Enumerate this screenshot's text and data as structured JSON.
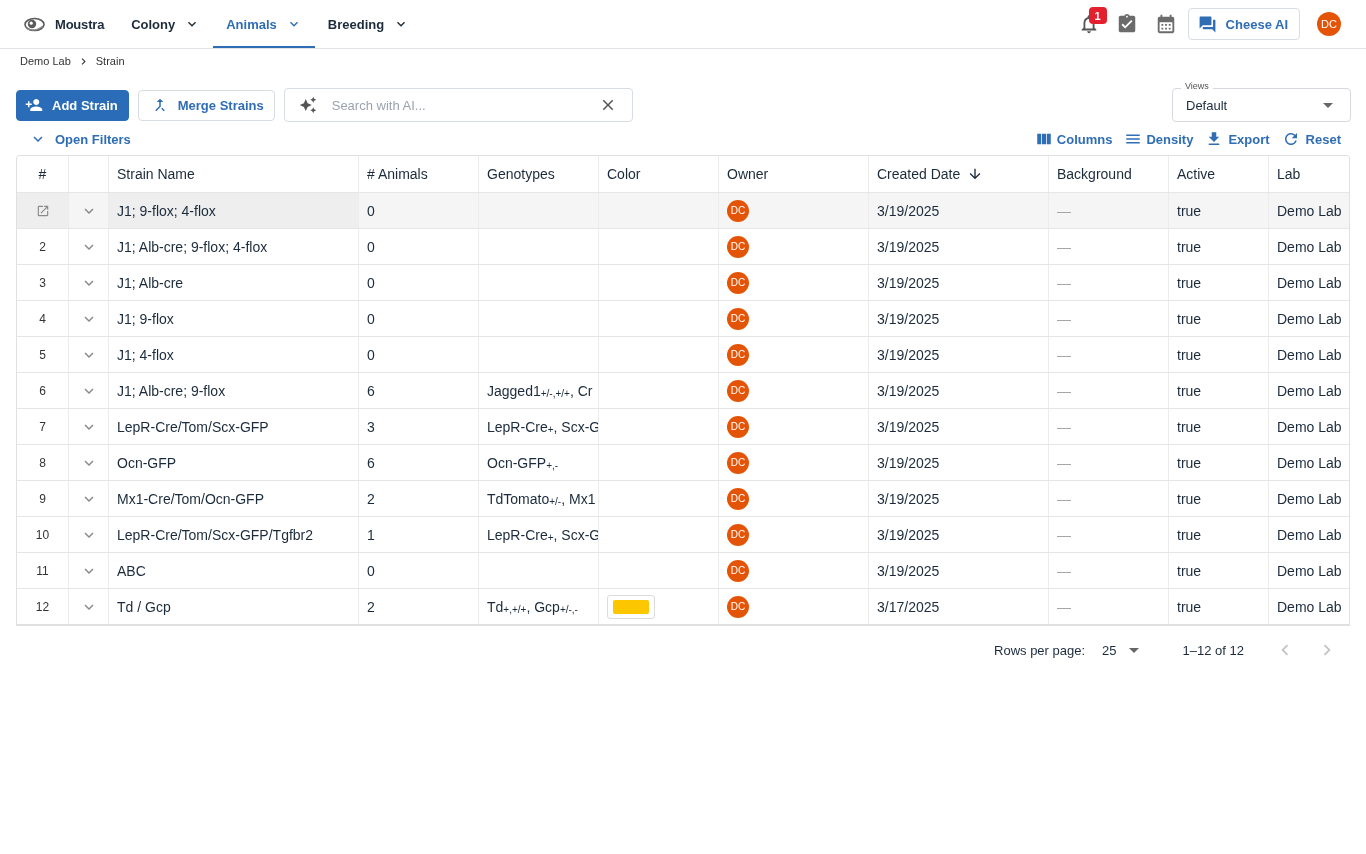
{
  "app": {
    "name": "Moustra"
  },
  "nav": [
    {
      "label": "Colony",
      "selected": false
    },
    {
      "label": "Animals",
      "selected": true
    },
    {
      "label": "Breeding",
      "selected": false
    }
  ],
  "header": {
    "notifications": {
      "count": "1"
    },
    "assistant_button": {
      "label": "Cheese AI"
    },
    "user": {
      "initials": "DC"
    }
  },
  "breadcrumb": [
    {
      "label": "Demo Lab"
    },
    {
      "label": "Strain"
    }
  ],
  "toolbar": {
    "buttons": [
      {
        "kind": "add",
        "label": "Add Strain"
      },
      {
        "kind": "merge",
        "label": "Merge Strains"
      }
    ],
    "search": {
      "placeholder": "Search with AI..."
    },
    "views": {
      "label": "Views",
      "value": "Default"
    }
  },
  "filters_toggle": {
    "label": "Open Filters"
  },
  "grid_actions": [
    {
      "kind": "columns",
      "label": "Columns"
    },
    {
      "kind": "density",
      "label": "Density"
    },
    {
      "kind": "export",
      "label": "Export"
    },
    {
      "kind": "reset",
      "label": "Reset"
    }
  ],
  "table": {
    "columns": [
      {
        "kind": "index",
        "label": "#"
      },
      {
        "kind": "expander"
      },
      {
        "kind": "text",
        "label": "Strain Name",
        "sorted": false
      },
      {
        "kind": "text",
        "label": "# Animals",
        "sorted": false
      },
      {
        "kind": "text",
        "label": "Genotypes",
        "sorted": false
      },
      {
        "kind": "text",
        "label": "Color",
        "sorted": false
      },
      {
        "kind": "text",
        "label": "Owner",
        "sorted": false
      },
      {
        "kind": "text",
        "label": "Created Date",
        "sorted": true,
        "descending": true
      },
      {
        "kind": "text",
        "label": "Background",
        "sorted": false
      },
      {
        "kind": "text",
        "label": "Active",
        "sorted": false
      },
      {
        "kind": "text",
        "label": "Lab",
        "sorted": false
      }
    ],
    "rows": [
      {
        "hovered": true,
        "expanded": false,
        "strain_name": "J1; 9-flox; 4-flox",
        "animals": "0",
        "owner": "DC",
        "created_date": "3/19/2025",
        "background": "—",
        "active": "true",
        "lab": "Demo Lab"
      },
      {
        "hovered": false,
        "expanded": false,
        "index": "2",
        "strain_name": "J1; Alb-cre; 9-flox; 4-flox",
        "animals": "0",
        "owner": "DC",
        "created_date": "3/19/2025",
        "background": "—",
        "active": "true",
        "lab": "Demo Lab"
      },
      {
        "hovered": false,
        "expanded": false,
        "index": "3",
        "strain_name": "J1; Alb-cre",
        "animals": "0",
        "owner": "DC",
        "created_date": "3/19/2025",
        "background": "—",
        "active": "true",
        "lab": "Demo Lab"
      },
      {
        "hovered": false,
        "expanded": false,
        "index": "4",
        "strain_name": "J1; 9-flox",
        "animals": "0",
        "owner": "DC",
        "created_date": "3/19/2025",
        "background": "—",
        "active": "true",
        "lab": "Demo Lab"
      },
      {
        "hovered": false,
        "expanded": false,
        "index": "5",
        "strain_name": "J1; 4-flox",
        "animals": "0",
        "owner": "DC",
        "created_date": "3/19/2025",
        "background": "—",
        "active": "true",
        "lab": "Demo Lab"
      },
      {
        "hovered": false,
        "expanded": false,
        "index": "6",
        "strain_name": "J1; Alb-cre; 9-flox",
        "animals": "6",
        "genotypes": "Jagged1$_{+/-,+/+}$, Cr",
        "owner": "DC",
        "created_date": "3/19/2025",
        "background": "—",
        "active": "true",
        "lab": "Demo Lab"
      },
      {
        "hovered": false,
        "expanded": false,
        "index": "7",
        "strain_name": "LepR-Cre/Tom/Scx-GFP",
        "animals": "3",
        "genotypes": "LepR-Cre$_{+}$, Scx-G",
        "owner": "DC",
        "created_date": "3/19/2025",
        "background": "—",
        "active": "true",
        "lab": "Demo Lab"
      },
      {
        "hovered": false,
        "expanded": false,
        "index": "8",
        "strain_name": "Ocn-GFP",
        "animals": "6",
        "genotypes": "Ocn-GFP$_{+,-}$",
        "owner": "DC",
        "created_date": "3/19/2025",
        "background": "—",
        "active": "true",
        "lab": "Demo Lab"
      },
      {
        "hovered": false,
        "expanded": false,
        "index": "9",
        "strain_name": "Mx1-Cre/Tom/Ocn-GFP",
        "animals": "2",
        "genotypes": "TdTomato$_{+/-}$, Mx1",
        "owner": "DC",
        "created_date": "3/19/2025",
        "background": "—",
        "active": "true",
        "lab": "Demo Lab"
      },
      {
        "hovered": false,
        "expanded": false,
        "index": "10",
        "strain_name": "LepR-Cre/Tom/Scx-GFP/Tgfbr2",
        "animals": "1",
        "genotypes": "LepR-Cre$_{+}$, Scx-G",
        "owner": "DC",
        "created_date": "3/19/2025",
        "background": "—",
        "active": "true",
        "lab": "Demo Lab"
      },
      {
        "hovered": false,
        "expanded": false,
        "index": "11",
        "strain_name": "ABC",
        "animals": "0",
        "owner": "DC",
        "created_date": "3/19/2025",
        "background": "—",
        "active": "true",
        "lab": "Demo Lab"
      },
      {
        "hovered": false,
        "expanded": false,
        "index": "12",
        "strain_name": "Td / Gcp",
        "animals": "2",
        "genotypes": "Td$_{+,+/+}$, Gcp$_{+/-,-}$",
        "color": "#fdc700",
        "owner": "DC",
        "created_date": "3/17/2025",
        "background": "—",
        "active": "true",
        "lab": "Demo Lab"
      }
    ]
  },
  "pagination": {
    "rows_per_page_label": "Rows per page:",
    "rows_per_page": "25",
    "range": "1–12 of 12",
    "previous_disabled": true,
    "next_disabled": true
  }
}
